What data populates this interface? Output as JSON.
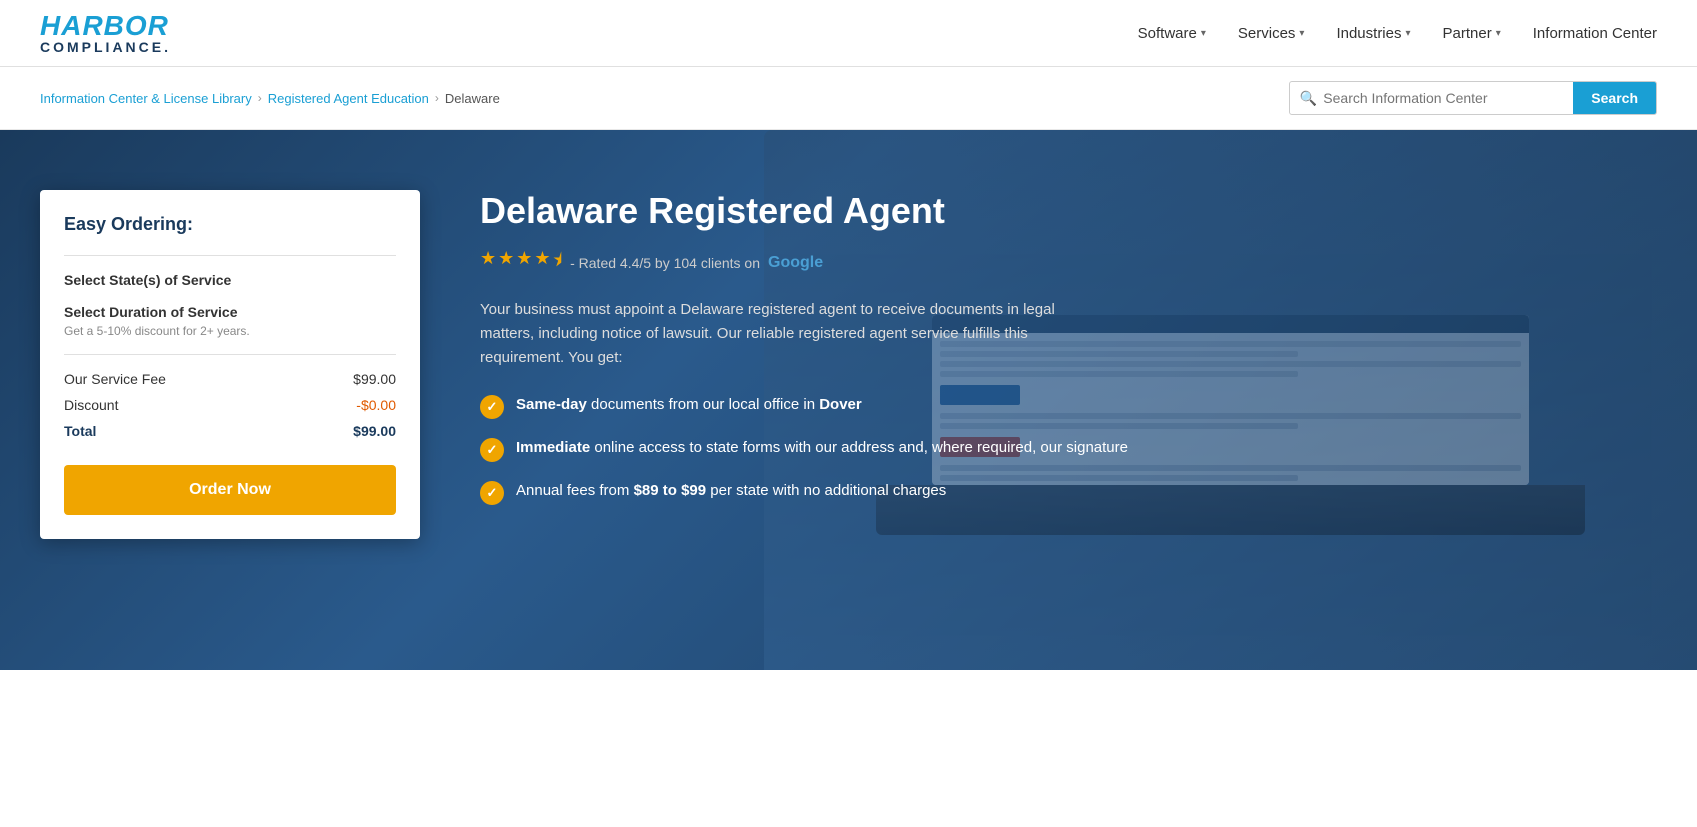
{
  "header": {
    "logo": {
      "harbor": "HARBOR",
      "compliance": "COMPLIANCE."
    },
    "nav": [
      {
        "label": "Software",
        "has_dropdown": true
      },
      {
        "label": "Services",
        "has_dropdown": true
      },
      {
        "label": "Industries",
        "has_dropdown": true
      },
      {
        "label": "Partner",
        "has_dropdown": true
      },
      {
        "label": "Information Center",
        "has_dropdown": false
      }
    ]
  },
  "breadcrumb": {
    "links": [
      {
        "label": "Information Center & License Library",
        "url": "#"
      },
      {
        "label": "Registered Agent Education",
        "url": "#"
      }
    ],
    "current": "Delaware"
  },
  "search": {
    "placeholder": "Search Information Center",
    "button_label": "Search"
  },
  "order_card": {
    "title": "Easy Ordering:",
    "fields": [
      {
        "label": "Select State(s) of Service"
      },
      {
        "label": "Select Duration of Service"
      }
    ],
    "discount_note": "Get a 5-10% discount for 2+ years.",
    "service_fee_label": "Our Service Fee",
    "service_fee_value": "$99.00",
    "discount_label": "Discount",
    "discount_value": "-$0.00",
    "total_label": "Total",
    "total_value": "$99.00",
    "button_label": "Order Now"
  },
  "hero": {
    "title": "Delaware Registered Agent",
    "rating": {
      "stars": 4.4,
      "score": "4.4/5",
      "count": "104",
      "platform": "Google",
      "text": "- Rated 4.4/5 by 104 clients on"
    },
    "description": "Your business must appoint a Delaware registered agent to receive documents in legal matters, including notice of lawsuit. Our reliable registered agent service fulfills this requirement. You get:",
    "bullets": [
      {
        "text_html": "<strong>Same-day</strong> documents from our local office in <strong>Dover</strong>"
      },
      {
        "text_html": "<strong>Immediate</strong> online access to state forms with our address and, where required, our signature"
      },
      {
        "text_html": "Annual fees from <strong>$89 to $99</strong> per state with no additional charges"
      }
    ]
  }
}
